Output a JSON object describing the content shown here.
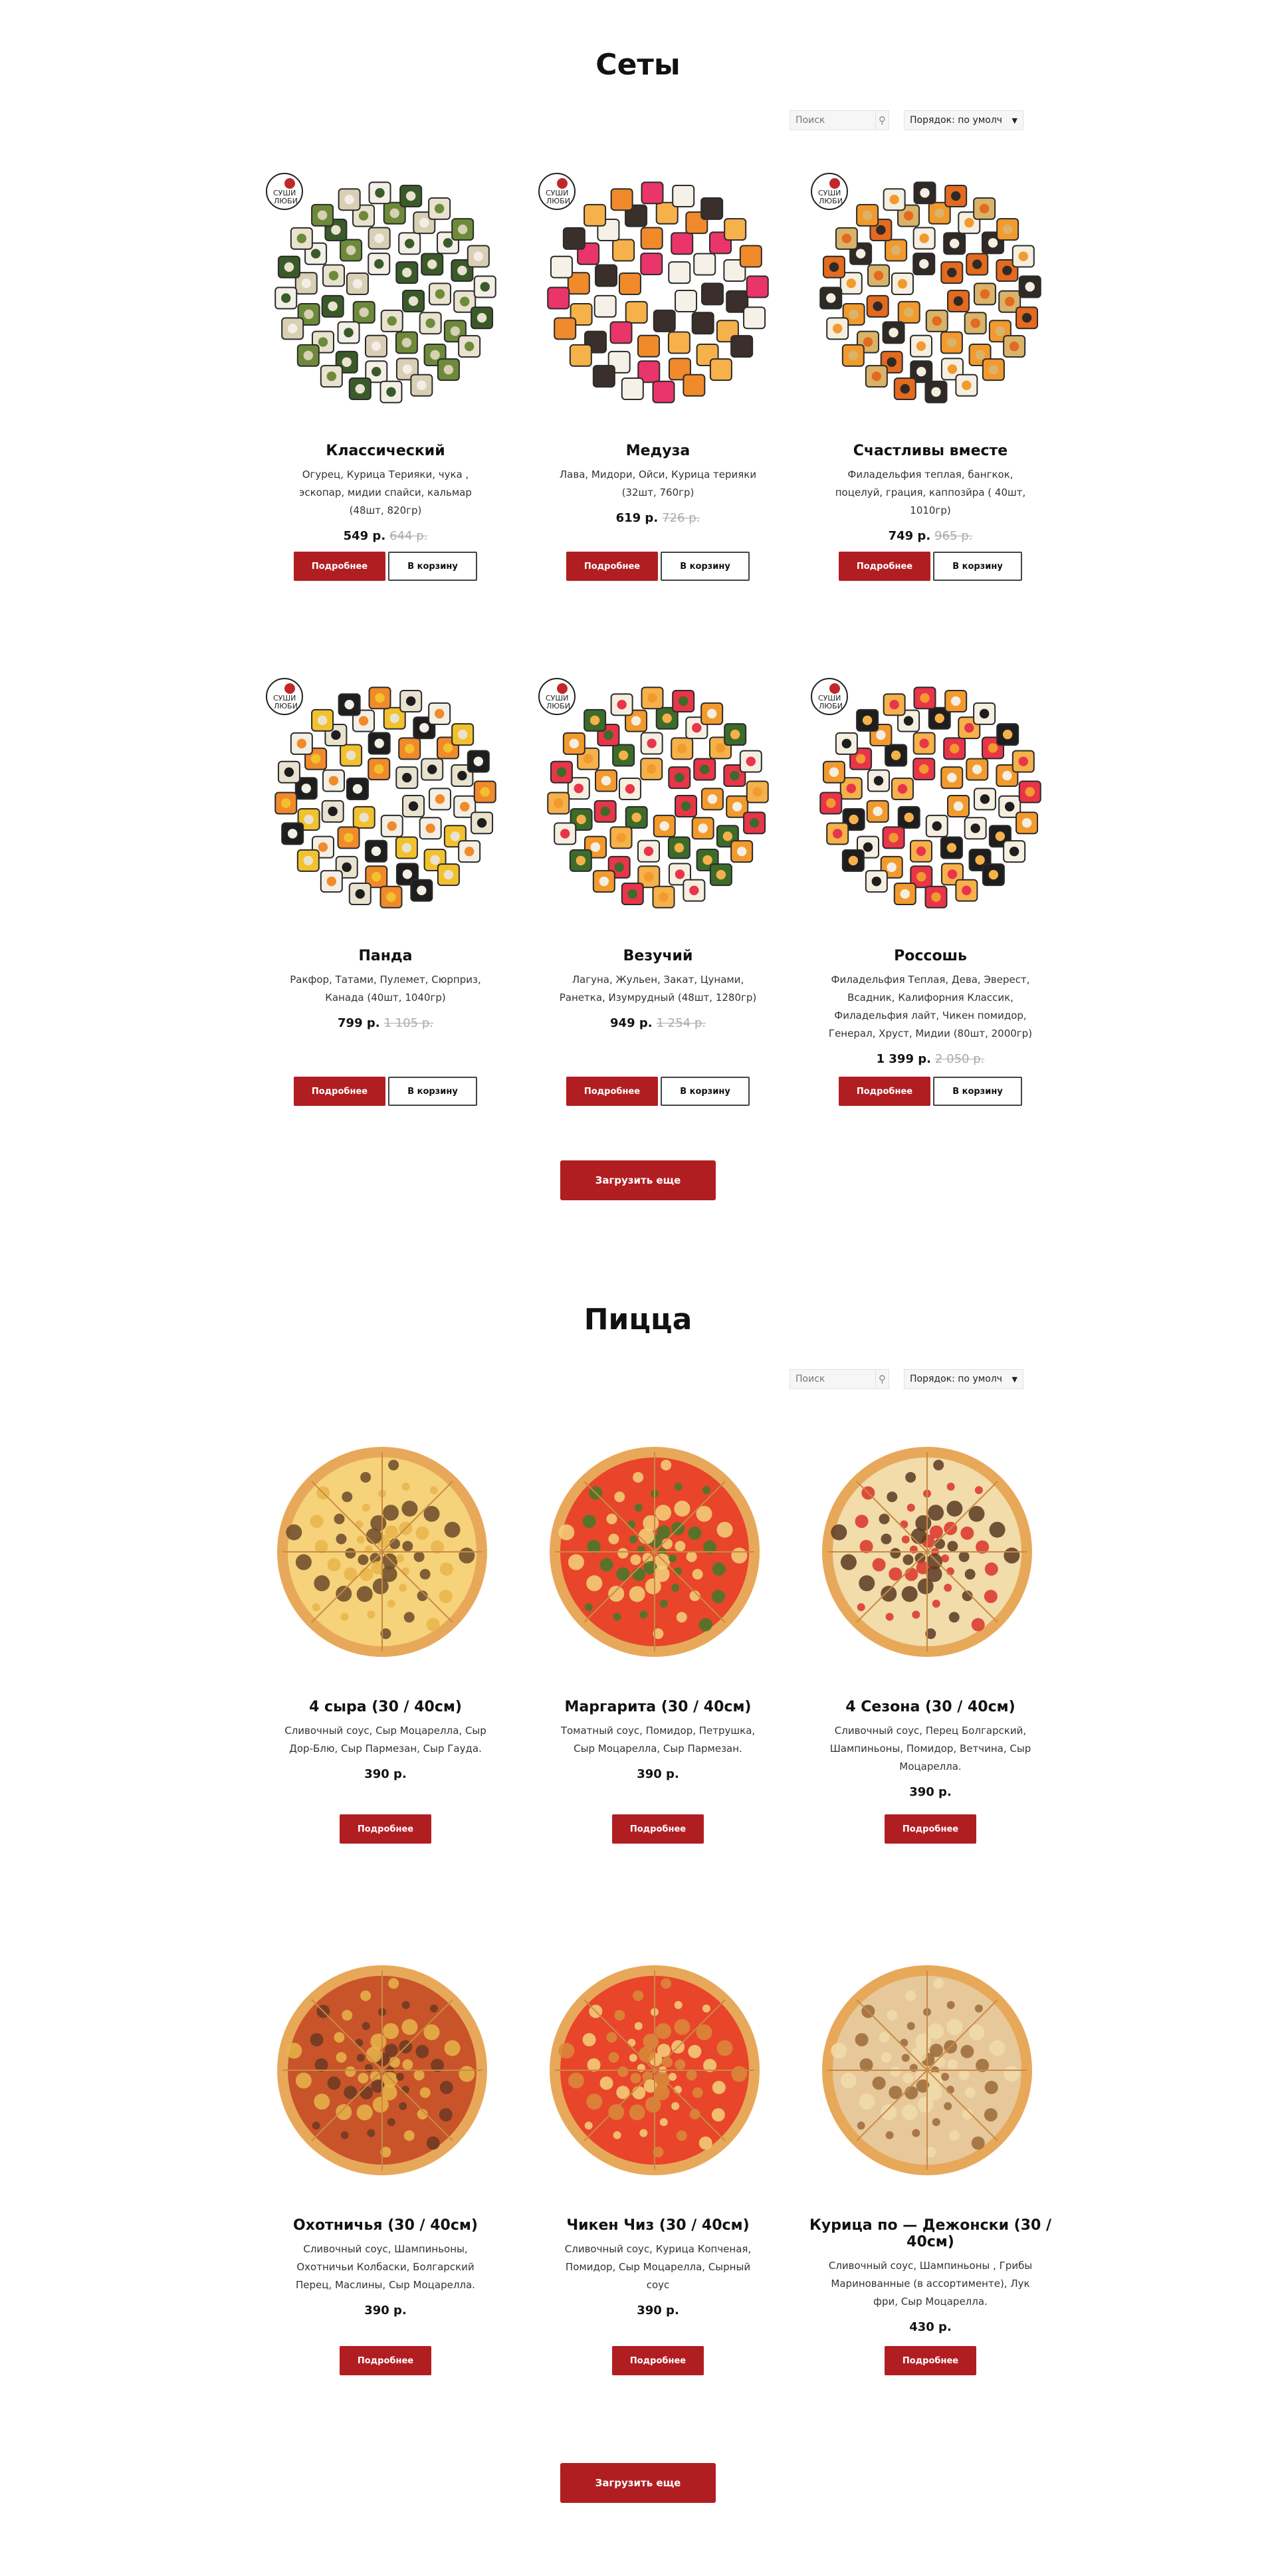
{
  "sets": {
    "title": "Сеты",
    "search_placeholder": "Поиск",
    "sort_label": "Порядок: по умолч",
    "brand_badge": "СУШИ ЛЮБИ",
    "items": [
      {
        "name": "Классический",
        "desc": "Огурец, Курица Терияки, чука , эскопар, мидии спайси, кальмар (48шт, 820гр)",
        "price": "549 р.",
        "old": "644 р."
      },
      {
        "name": "Медуза",
        "desc": "Лава, Мидори, Ойси, Курица терияки (32шт, 760гр)",
        "price": "619 р.",
        "old": "726 р."
      },
      {
        "name": "Счастливы вместе",
        "desc": "Филадельфия теплая, бангкок, поцелуй, грация, каппозйра ( 40шт, 1010гр)",
        "price": "749 р.",
        "old": "965 р."
      },
      {
        "name": "Панда",
        "desc": "Ракфор, Татами, Пулемет, Сюрприз, Канада (40шт, 1040гр)",
        "price": "799 р.",
        "old": "1 105 р."
      },
      {
        "name": "Везучий",
        "desc": "Лагуна, Жульен, Закат, Цунами, Ранетка, Изумрудный (48шт, 1280гр)",
        "price": "949 р.",
        "old": "1 254 р."
      },
      {
        "name": "Россошь",
        "desc": "Филадельфия Теплая, Дева, Эверест, Всадник, Калифорния Классик, Филадельфия лайт, Чикен помидор, Генерал, Хруст, Мидии (80шт, 2000гр)",
        "price": "1 399 р.",
        "old": "2 050 р."
      }
    ],
    "more_label": "Подробнее",
    "cart_label": "В корзину",
    "load_more": "Загрузить еще"
  },
  "pizza": {
    "title": "Пицца",
    "search_placeholder": "Поиск",
    "sort_label": "Порядок: по умолч",
    "items": [
      {
        "name": "4 сыра (30 / 40см)",
        "desc": "Сливочный соус, Сыр Моцарелла, Сыр Дор-Блю, Сыр Пармезан, Сыр Гауда.",
        "price": "390 р."
      },
      {
        "name": "Маргарита (30 / 40см)",
        "desc": "Томатный соус, Помидор, Петрушка, Сыр Моцарелла, Сыр Пармезан.",
        "price": "390 р."
      },
      {
        "name": "4 Сезона (30 / 40см)",
        "desc": "Сливочный соус, Перец Болгарский, Шампиньоны, Помидор, Ветчина, Сыр Моцарелла.",
        "price": "390 р."
      },
      {
        "name": "Охотничья (30 / 40см)",
        "desc": "Сливочный соус, Шампиньоны, Охотничьи Колбаски, Болгарский Перец, Маслины, Сыр Моцарелла.",
        "price": "390 р."
      },
      {
        "name": "Чикен Чиз (30 / 40см)",
        "desc": "Сливочный соус, Курица Копченая, Помидор, Сыр Моцарелла, Сырный соус",
        "price": "390 р."
      },
      {
        "name": "Курица по — Дежонски (30 / 40см)",
        "desc": "Сливочный соус, Шампиньоны , Грибы Маринованные (в ассортименте), Лук фри, Сыр Моцарелла.",
        "price": "430 р."
      }
    ],
    "more_label": "Подробнее",
    "load_more": "Загрузить еще"
  },
  "colors": {
    "accent": "#b11e22"
  }
}
